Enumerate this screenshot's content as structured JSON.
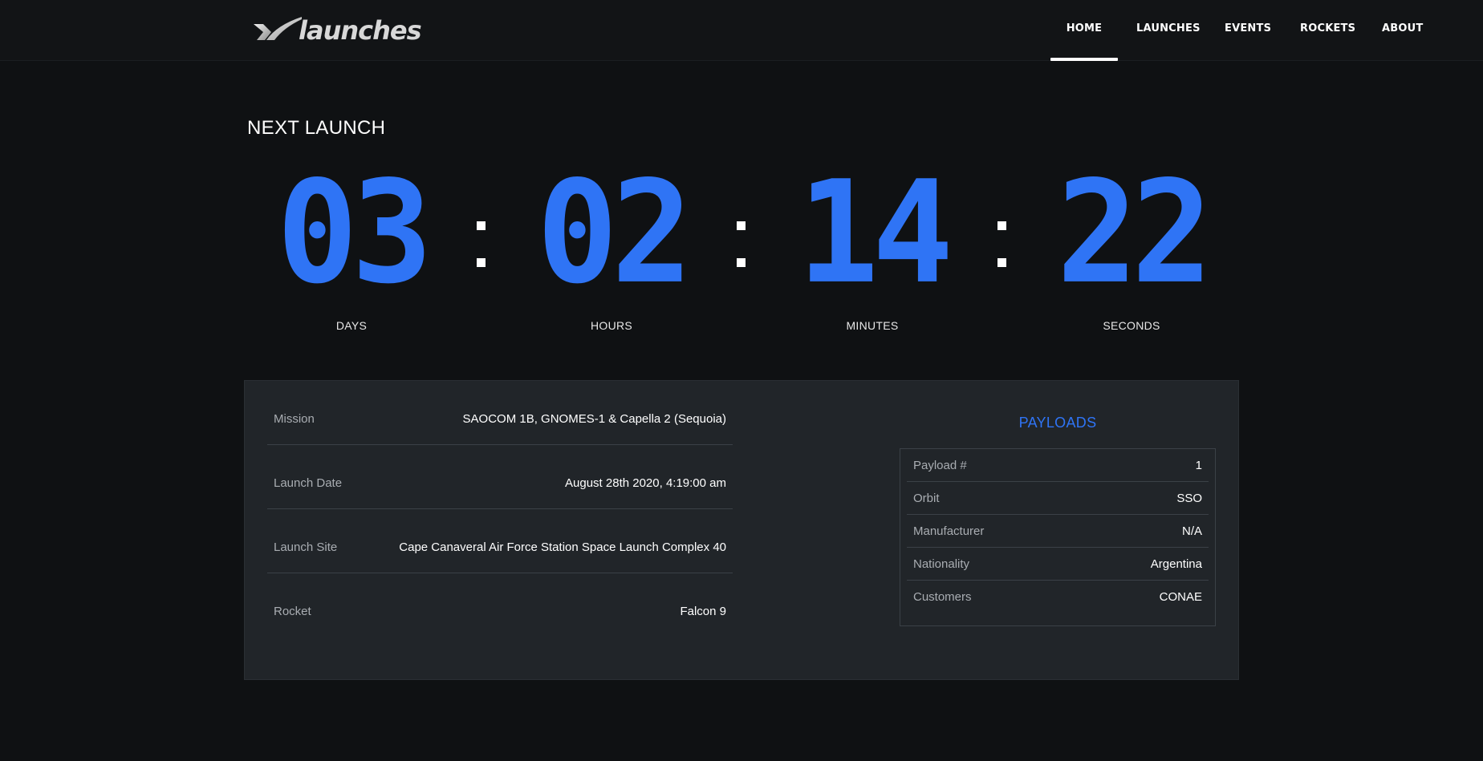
{
  "brand": {
    "name": "launches",
    "accent": "#2f74f5"
  },
  "nav": {
    "items": [
      {
        "label": "HOME",
        "active": true
      },
      {
        "label": "LAUNCHES",
        "active": false
      },
      {
        "label": "EVENTS",
        "active": false
      },
      {
        "label": "ROCKETS",
        "active": false
      },
      {
        "label": "ABOUT",
        "active": false
      }
    ]
  },
  "next_launch": {
    "title": "NEXT LAUNCH",
    "countdown": {
      "days": {
        "value": "03",
        "label": "DAYS"
      },
      "hours": {
        "value": "02",
        "label": "HOURS"
      },
      "minutes": {
        "value": "14",
        "label": "MINUTES"
      },
      "seconds": {
        "value": "22",
        "label": "SECONDS"
      }
    }
  },
  "details": {
    "rows": [
      {
        "label": "Mission",
        "value": "SAOCOM 1B, GNOMES-1 & Capella 2 (Sequoia)"
      },
      {
        "label": "Launch Date",
        "value": "August 28th 2020, 4:19:00 am"
      },
      {
        "label": "Launch Site",
        "value": "Cape Canaveral Air Force Station Space Launch Complex 40"
      },
      {
        "label": "Rocket",
        "value": "Falcon 9"
      }
    ]
  },
  "payloads": {
    "title": "PAYLOADS",
    "rows": [
      {
        "label": "Payload #",
        "value": "1"
      },
      {
        "label": "Orbit",
        "value": "SSO"
      },
      {
        "label": "Manufacturer",
        "value": "N/A"
      },
      {
        "label": "Nationality",
        "value": "Argentina"
      },
      {
        "label": "Customers",
        "value": "CONAE"
      }
    ]
  }
}
